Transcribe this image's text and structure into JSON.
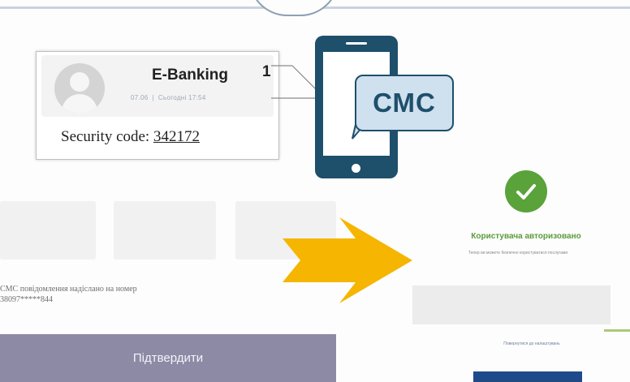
{
  "notification": {
    "sender": "E-Banking",
    "count": "1",
    "date": "07.06",
    "day": "Сьогодні 17:54",
    "code_label": "Security code:",
    "code_value": "342172"
  },
  "bubble": {
    "label": "СМС"
  },
  "form": {
    "sms_info_line1": "СМС повідомлення надіслано на номер",
    "sms_info_line2": "38097*****844",
    "confirm_label": "Підтвердити"
  },
  "auth": {
    "title": "Користувача авторизовано",
    "subtitle": "Тепер ви можете безпечно користуватися послугами",
    "link": "Повернутися до налаштувань",
    "button_label": ""
  },
  "colors": {
    "phone": "#1e4f6b",
    "bubble": "#cfe0ee",
    "arrow": "#f5b500",
    "check": "#5aa23a",
    "confirm_button": "#8d8aa6"
  },
  "icons": [
    "avatar-icon",
    "phone-icon",
    "arrow-right-icon",
    "check-icon"
  ]
}
